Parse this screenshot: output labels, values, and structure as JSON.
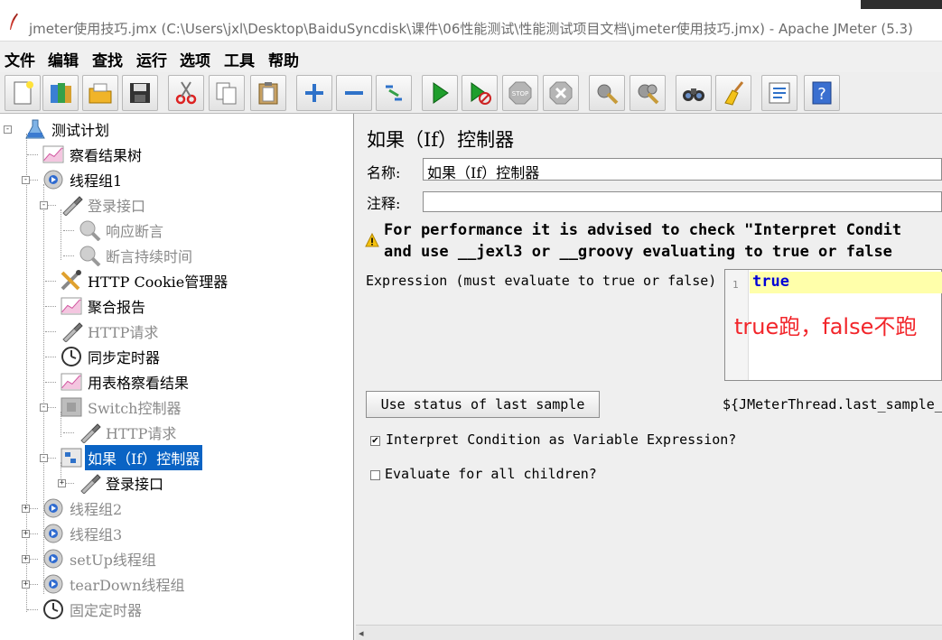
{
  "window": {
    "title": "jmeter使用技巧.jmx (C:\\Users\\jxl\\Desktop\\BaiduSyncdisk\\课件\\06性能测试\\性能测试项目文档\\jmeter使用技巧.jmx) - Apache JMeter (5.3)"
  },
  "menu": [
    "文件",
    "编辑",
    "查找",
    "运行",
    "选项",
    "工具",
    "帮助"
  ],
  "toolbar": [
    {
      "icon": "new-icon"
    },
    {
      "icon": "templates-icon"
    },
    {
      "icon": "open-icon"
    },
    {
      "icon": "save-icon"
    },
    {
      "icon": "cut-icon"
    },
    {
      "icon": "copy-icon"
    },
    {
      "icon": "paste-icon"
    },
    {
      "icon": "expand-icon"
    },
    {
      "icon": "collapse-icon"
    },
    {
      "icon": "toggle-icon"
    },
    {
      "icon": "start-icon"
    },
    {
      "icon": "start-no-pause-icon"
    },
    {
      "icon": "stop-icon"
    },
    {
      "icon": "shutdown-icon"
    },
    {
      "icon": "clear-icon"
    },
    {
      "icon": "clear-all-icon"
    },
    {
      "icon": "search-icon"
    },
    {
      "icon": "reset-search-icon"
    },
    {
      "icon": "function-helper-icon"
    },
    {
      "icon": "help-icon"
    }
  ],
  "tree": [
    {
      "label": "测试计划",
      "icon": "flask-icon",
      "state": "normal"
    },
    {
      "label": "察看结果树",
      "icon": "chart-icon",
      "state": "normal"
    },
    {
      "label": "线程组1",
      "icon": "thread-group-icon",
      "state": "normal"
    },
    {
      "label": "登录接口",
      "icon": "pipette-icon",
      "state": "disabled"
    },
    {
      "label": "响应断言",
      "icon": "magnifier-icon",
      "state": "disabled"
    },
    {
      "label": "断言持续时间",
      "icon": "magnifier-icon",
      "state": "disabled"
    },
    {
      "label": "HTTP Cookie管理器",
      "icon": "tools-icon",
      "state": "normal"
    },
    {
      "label": "聚合报告",
      "icon": "chart-icon",
      "state": "normal"
    },
    {
      "label": "HTTP请求",
      "icon": "pipette-icon",
      "state": "disabled"
    },
    {
      "label": "同步定时器",
      "icon": "timer-icon",
      "state": "normal"
    },
    {
      "label": "用表格察看结果",
      "icon": "chart-icon",
      "state": "normal"
    },
    {
      "label": "Switch控制器",
      "icon": "switch-icon",
      "state": "disabled"
    },
    {
      "label": "HTTP请求",
      "icon": "pipette-icon",
      "state": "disabled"
    },
    {
      "label": "如果（If）控制器",
      "icon": "if-controller-icon",
      "state": "selected"
    },
    {
      "label": "登录接口",
      "icon": "pipette-icon",
      "state": "normal"
    },
    {
      "label": "线程组2",
      "icon": "thread-group-icon",
      "state": "disabled"
    },
    {
      "label": "线程组3",
      "icon": "thread-group-icon",
      "state": "disabled"
    },
    {
      "label": "setUp线程组",
      "icon": "thread-group-icon",
      "state": "disabled"
    },
    {
      "label": "tearDown线程组",
      "icon": "thread-group-icon",
      "state": "disabled"
    },
    {
      "label": "固定定时器",
      "icon": "timer-icon",
      "state": "disabled"
    }
  ],
  "panel": {
    "title": "如果（If）控制器",
    "name_label": "名称:",
    "name_value": "如果（If）控制器",
    "comment_label": "注释:",
    "comment_value": "",
    "warning_line1": "For performance it is advised to check \"Interpret Condit",
    "warning_line2": "and use __jexl3 or __groovy evaluating to true or false",
    "expression_label": "Expression (must evaluate to true or false)",
    "line_number": "1",
    "expression_value": "true",
    "annotation": "true跑，false不跑",
    "status_button": "Use status of last sample",
    "status_expression": "${JMeterThread.last_sample_",
    "interpret_checked": true,
    "interpret_label": "Interpret Condition as Variable Expression?",
    "evaluate_checked": false,
    "evaluate_label": "Evaluate for all children?"
  }
}
